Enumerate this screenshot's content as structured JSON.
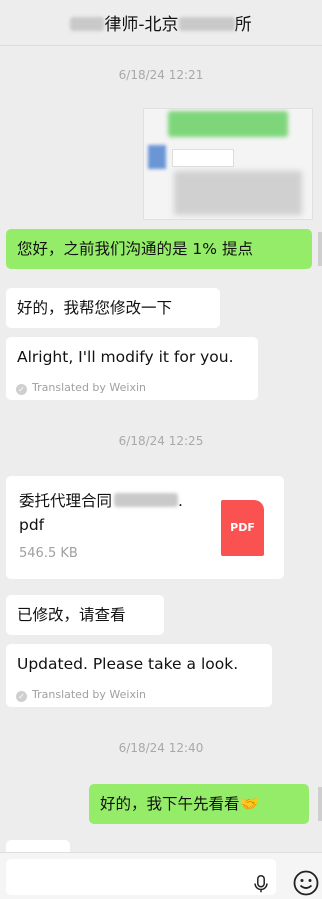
{
  "header": {
    "title_part1": "律师-北京",
    "title_part2": "所"
  },
  "messages": {
    "ts1": "6/18/24 12:21",
    "msg1": "您好，之前我们沟通的是 1% 提点",
    "msg2": "好的，我帮您修改一下",
    "msg2_translation": "Alright, I'll modify it for you.",
    "translated_by": "Translated by Weixin",
    "ts2": "6/18/24 12:25",
    "file_name": "委托代理合同",
    "file_dot": ".",
    "file_ext": "pdf",
    "file_size": "546.5 KB",
    "file_icon_label": "PDF",
    "msg3": "已修改，请查看",
    "msg3_translation": "Updated. Please take a look.",
    "ts3": "6/18/24 12:40",
    "msg4": "好的，我下午先看看🤝"
  },
  "icons": {
    "mic": "microphone-icon",
    "emoji": "emoji-icon",
    "translate": "translate-check-icon"
  },
  "colors": {
    "sent_bubble": "#95ec69",
    "pdf_red": "#fa5151",
    "background": "#ededed"
  }
}
